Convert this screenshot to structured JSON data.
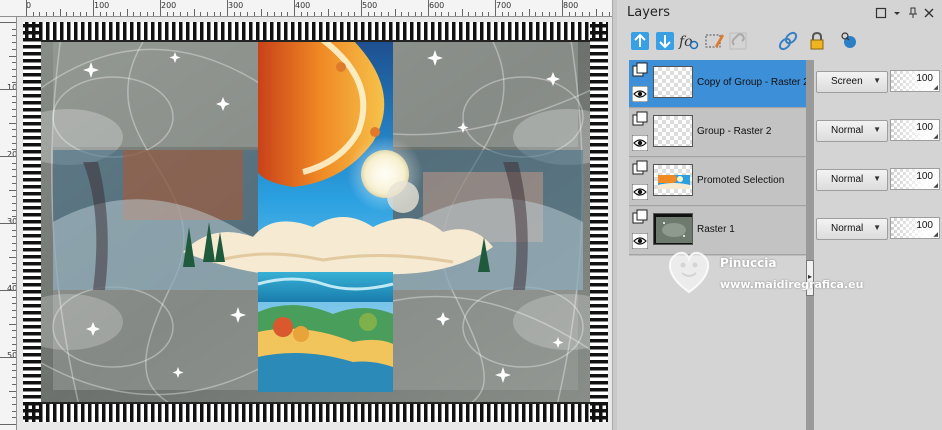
{
  "ruler_top": {
    "labels": [
      "0",
      "100",
      "200",
      "300",
      "400",
      "500",
      "600",
      "700",
      "800"
    ]
  },
  "ruler_left": {
    "labels": [
      "100",
      "200",
      "300",
      "400",
      "500"
    ]
  },
  "layers_panel": {
    "title": "Layers",
    "title_buttons": [
      "maximize-icon",
      "dropdown-icon",
      "pin-icon",
      "close-icon"
    ],
    "toolbar": [
      "new-raster-layer-icon",
      "new-vector-layer-icon",
      "new-art-media-layer-icon",
      "edit-selection-icon",
      "link-layer-icon",
      "chain-icon",
      "lock-icon",
      "mask-icon"
    ],
    "layers": [
      {
        "name": "Copy of Group - Raster 2",
        "blend_mode": "Screen",
        "opacity": "100",
        "selected": true,
        "visible": true
      },
      {
        "name": "Group - Raster 2",
        "blend_mode": "Normal",
        "opacity": "100",
        "selected": false,
        "visible": true
      },
      {
        "name": "Promoted Selection",
        "blend_mode": "Normal",
        "opacity": "100",
        "selected": false,
        "visible": true
      },
      {
        "name": "Raster 1",
        "blend_mode": "Normal",
        "opacity": "100",
        "selected": false,
        "visible": true
      }
    ]
  },
  "watermark": {
    "name": "Pinuccia",
    "site": "www.maidiregrafica.eu"
  },
  "colors": {
    "selected_row": "#3d8fd8",
    "panel_bg": "#d4d4d4",
    "canvas_bg": "#7a7f7a"
  }
}
